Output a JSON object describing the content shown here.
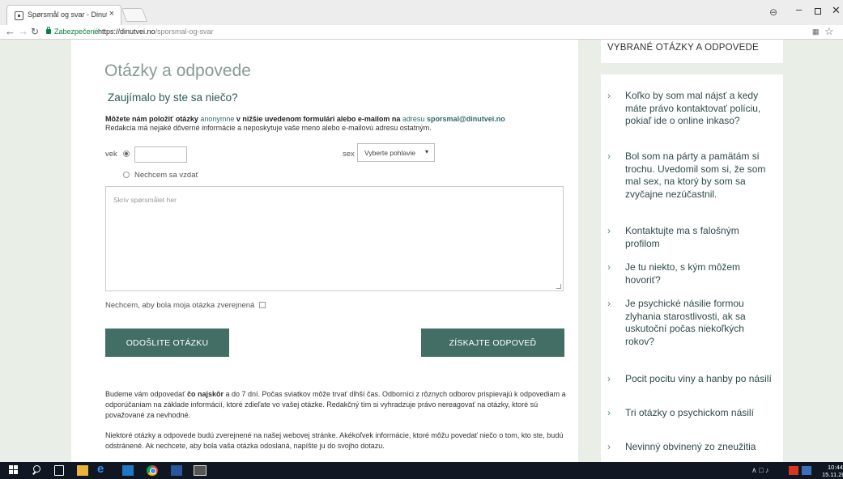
{
  "browser": {
    "tab_title": "Spørsmål og svar - Dinut",
    "tab_close": "×",
    "secure_label": "Zabezpečené",
    "url_sep": "|",
    "url_base": "https://dinutvei.no",
    "url_path": "/sporsmal-og-svar",
    "icons": [
      "favicon-icon",
      "back-icon",
      "forward-icon",
      "reload-icon",
      "lock-icon",
      "translate-icon",
      "star-icon",
      "profile-icon",
      "minimize-icon",
      "maximize-icon",
      "close-icon"
    ]
  },
  "main": {
    "title": "Otázky a odpovede",
    "subtitle": "Zaujímalo by ste sa niečo?",
    "intro": {
      "part1": "Môžete nám položiť otázky ",
      "link_anon": "anonymne",
      "part2": " v nižšie uvedenom formulári alebo e-mailom na ",
      "link_addr": "adresu",
      "part3": " sporsmal@dinutvei.no",
      "line2": "Redakcia má nejaké dôverné informácie a neposkytuje vaše meno alebo e-mailovú adresu ostatným."
    },
    "form": {
      "age_label": "vek",
      "age_value": "",
      "no_age_label": "Nechcem sa vzdať",
      "sex_label": "sex",
      "sex_selected": "Vyberte pohlavie",
      "sex_caret": "▾",
      "question_placeholder": "Skriv spørsmålet her",
      "no_publish_label": "Nechcem, aby bola moja otázka zverejnená",
      "no_publish_checked": false,
      "send_button": "ODOŠLITE OTÁZKU",
      "answer_button": "ZÍSKAJTE ODPOVEĎ"
    },
    "info1_a": "Budeme vám odpovedať ",
    "info1_bold": "čo najskôr",
    "info1_b": " a do 7 dní. Počas sviatkov môže trvať dlhší čas. Odborníci z rôznych odborov prispievajú k odpovediam a odporúčaniam na základe informácií, ktoré zdieľate vo vašej otázke. Redakčný tím si vyhradzuje právo nereagovať na otázky, ktoré sú považované za nevhodné.",
    "info2": "Niektoré otázky a odpovede budú zverejnené na našej webovej stránke. Akékoľvek informácie, ktoré môžu povedať niečo o tom, kto ste, budú odstránené. Ak nechcete, aby bola vaša otázka odoslaná, napíšte ju do svojho dotazu."
  },
  "sidebar": {
    "heading": "VYBRANÉ OTÁZKY A ODPOVEDE",
    "chevron": "›",
    "items": [
      {
        "label": "Koľko by som mal nájsť a kedy máte právo kontaktovať políciu, pokiaľ ide o online inkaso?"
      },
      {
        "label": "Bol som na párty a pamätám si trochu. Uvedomil som si, že som mal sex, na ktorý by som sa zvyčajne nezúčastnil."
      },
      {
        "label": "Kontaktujte ma s falošným profilom"
      },
      {
        "label": "Je tu niekto, s kým môžem hovoriť?"
      },
      {
        "label": "Je psychické násilie formou zlyhania starostlivosti, ak sa uskutoční počas niekoľkých rokov?"
      },
      {
        "label": "Pocit pocitu viny a hanby po násilí"
      },
      {
        "label": "Tri otázky o psychickom násilí"
      },
      {
        "label": "Nevinný obvinený zo zneužitia"
      }
    ]
  },
  "taskbar": {
    "icons": [
      "windows-start-icon",
      "search-icon",
      "task-view-icon",
      "file-explorer-icon",
      "edge-icon",
      "store-icon",
      "chrome-icon",
      "word-icon",
      "photos-icon"
    ],
    "clock_time": "10:44",
    "clock_date": "15.11.201"
  },
  "colors": {
    "accent": "#426e66",
    "link": "#2e6868",
    "background": "#e9eee7"
  }
}
